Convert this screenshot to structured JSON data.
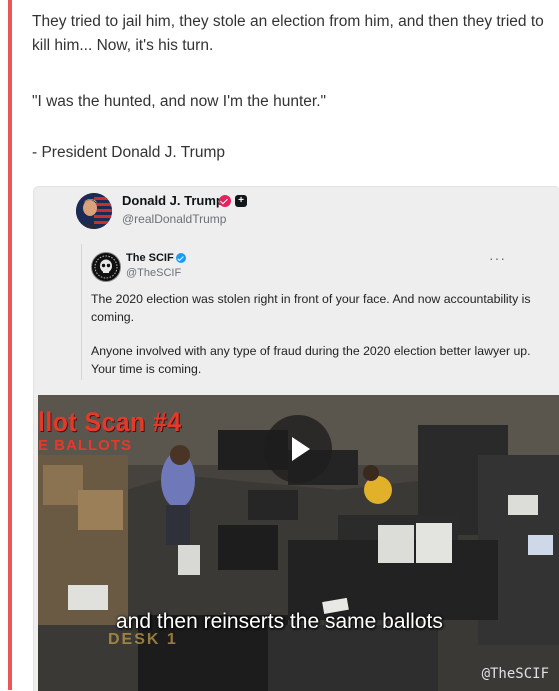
{
  "post": {
    "paragraph1": "They tried to jail him, they stole an election from him, and then they tried to kill him... Now, it's his turn.",
    "paragraph2": "\"I was the hunted, and now I'm the hunter.\"",
    "paragraph3": "- President Donald J. Trump"
  },
  "embed": {
    "author_name": "Donald J. Trump",
    "author_handle": "@realDonaldTrump",
    "quoted": {
      "author_name": "The SCIF",
      "author_handle": "@TheSCIF",
      "more": "···",
      "text1": "The 2020 election was stolen right in front of your face. And now accountability is coming.",
      "text2": "Anyone involved with any type of fraud during the 2020 election better lawyer up. Your time is coming."
    },
    "video": {
      "overlay_title": "llot Scan #4",
      "overlay_subtitle": "E BALLOTS",
      "caption": "and then reinserts the same ballots",
      "background_sign": "DESK 1",
      "watermark": "@TheSCIF"
    }
  },
  "colors": {
    "accent": "#e8585a",
    "verified_pink": "#e0245e",
    "verified_blue": "#1d9bf0",
    "overlay_red": "#e53a2a"
  }
}
